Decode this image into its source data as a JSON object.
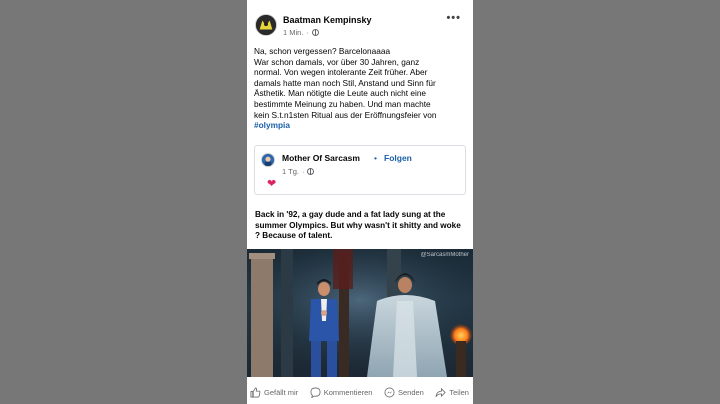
{
  "post": {
    "author": "Baatman Kempinsky",
    "time": "1 Min.",
    "more_icon": "more-horizontal-icon",
    "text_lines": [
      "Na, schon vergessen? Barcelonaaaa",
      "War schon damals, vor über 30 Jahren, ganz",
      "normal. Von wegen intolerante Zeit früher. Aber",
      "damals hatte man noch Stil, Anstand und Sinn für",
      "Ästhetik. Man nötigte die Leute auch nicht eine",
      "bestimmte Meinung zu haben. Und man machte",
      "kein S.t.n1sten Ritual aus der Eröffnungsfeier von"
    ],
    "hashtag": "#olympia"
  },
  "shared": {
    "name": "Mother Of Sarcasm",
    "separator": "•",
    "follow_label": "Folgen",
    "time": "1 Tg.",
    "reaction": "❤"
  },
  "caption": "Back in '92, a gay dude and a fat lady sung at the summer Olympics. But why wasn't it shitty and woke ? Because of talent.",
  "video": {
    "watermark": "@SarcasmMother"
  },
  "actions": {
    "like": "Gefällt mir",
    "comment": "Kommentieren",
    "send": "Senden",
    "share": "Teilen"
  },
  "colors": {
    "background": "#777777",
    "link": "#1b5fa8",
    "heart": "#e0245e",
    "muted": "#65676b"
  }
}
